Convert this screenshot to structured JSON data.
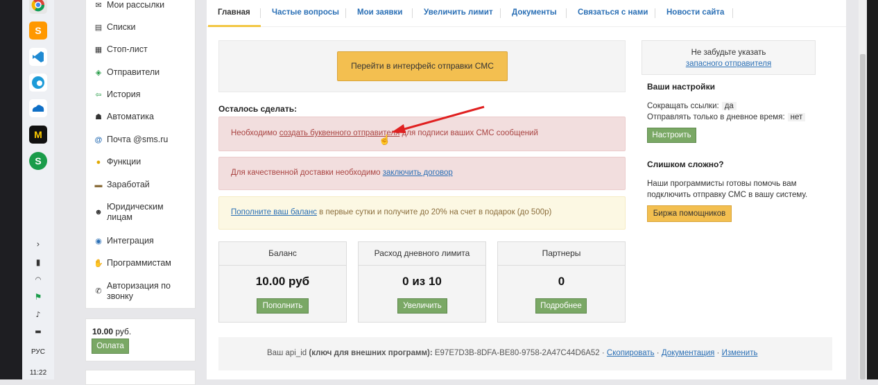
{
  "taskbar": {
    "apps": [
      "chrome-icon",
      "sublime-icon",
      "vscode-icon",
      "edge-icon",
      "onedrive-icon",
      "miranda-icon",
      "s-app-icon"
    ],
    "lang": "РУС",
    "time": "11:22"
  },
  "sidebar": {
    "items": [
      {
        "label": "Мои рассылки",
        "icon": "mail-icon"
      },
      {
        "label": "Списки",
        "icon": "list-icon"
      },
      {
        "label": "Стоп-лист",
        "icon": "stop-list-icon"
      },
      {
        "label": "Отправители",
        "icon": "tag-icon"
      },
      {
        "label": "История",
        "icon": "history-icon"
      },
      {
        "label": "Автоматика",
        "icon": "automation-icon"
      },
      {
        "label": "Почта @sms.ru",
        "icon": "at-icon"
      },
      {
        "label": "Функции",
        "icon": "bulb-icon"
      },
      {
        "label": "Заработай",
        "icon": "money-icon"
      },
      {
        "label": "Юридическим лицам",
        "icon": "person-icon"
      },
      {
        "label": "Интеграция",
        "icon": "integration-icon"
      },
      {
        "label": "Программистам",
        "icon": "hand-icon"
      },
      {
        "label": "Авторизация по звонку",
        "icon": "phone-icon"
      }
    ],
    "balance_amount": "10.00",
    "balance_unit": "руб.",
    "pay_label": "Оплата"
  },
  "tabs": [
    {
      "label": "Главная",
      "active": true
    },
    {
      "label": "Частые вопросы"
    },
    {
      "label": "Мои заявки"
    },
    {
      "label": "Увеличить лимит"
    },
    {
      "label": "Документы"
    },
    {
      "label": "Связаться с нами"
    },
    {
      "label": "Новости сайта"
    }
  ],
  "main": {
    "send_button": "Перейти в интерфейс отправки СМС",
    "todo_title": "Осталось сделать:",
    "alert1": {
      "before": "Необходимо ",
      "link": "создать буквенного отправителя",
      "after": " для подписи ваших СМС сообщений"
    },
    "alert2": {
      "before": "Для качественной доставки необходимо ",
      "link": "заключить договор"
    },
    "alert3": {
      "link": "Пополните ваш баланс",
      "after": " в первые сутки и получите до 20% на счет в подарок (до 500р)"
    },
    "cards": [
      {
        "title": "Баланс",
        "value": "10.00 руб",
        "button": "Пополнить"
      },
      {
        "title": "Расход дневного лимита",
        "value": "0 из 10",
        "button": "Увеличить"
      },
      {
        "title": "Партнеры",
        "value": "0",
        "button": "Подробнее"
      }
    ],
    "api": {
      "label_prefix": "Ваш api_id ",
      "label_bold": "(ключ для внешних программ)",
      "colon": ": ",
      "value": "E97E7D3B-8DFA-BE80-9758-2A47C44D6A52",
      "sep": " · ",
      "copy": "Скопировать",
      "docs": "Документация",
      "change": "Изменить"
    }
  },
  "right": {
    "note_line1": "Не забудьте указать",
    "note_link": "запасного отправителя",
    "settings_title": "Ваши настройки",
    "shorten_label": "Сокращать ссылки:",
    "shorten_value": "да",
    "daytime_label": "Отправлять только в дневное время:",
    "daytime_value": "нет",
    "configure_button": "Настроить",
    "hard_title": "Слишком сложно?",
    "hard_text1": "Наши программисты готовы помочь вам",
    "hard_text2": "подключить отправку СМС в вашу систему.",
    "helpers_button": "Биржа помощников"
  },
  "colors": {
    "accent_yellow": "#f3bf50",
    "green_button": "#7aa865",
    "link": "#2a6fb5",
    "arrow": "#e02020"
  }
}
